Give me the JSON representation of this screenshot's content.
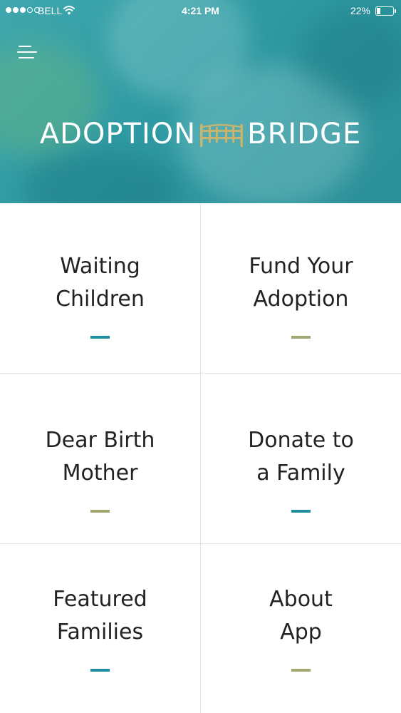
{
  "status_bar": {
    "carrier": "BELL",
    "time": "4:21 PM",
    "battery_percent": "22%",
    "battery_level": 0.22,
    "signal_bars_filled": 3,
    "signal_bars_total": 5
  },
  "header": {
    "logo_left": "ADOPTION",
    "logo_right": "BRIDGE",
    "logo_icon": "bridge-icon",
    "menu_icon": "hamburger-menu-icon"
  },
  "colors": {
    "teal_accent": "#1f8ea3",
    "olive_accent": "#a3a872",
    "bridge_gold": "#c9b46e",
    "hero_teal": "#35a2a9"
  },
  "tiles": [
    {
      "label_line1": "Waiting",
      "label_line2": "Children",
      "accent": "teal"
    },
    {
      "label_line1": "Fund Your",
      "label_line2": "Adoption",
      "accent": "olive"
    },
    {
      "label_line1": "Dear Birth",
      "label_line2": "Mother",
      "accent": "olive"
    },
    {
      "label_line1": "Donate to",
      "label_line2": "a Family",
      "accent": "teal"
    },
    {
      "label_line1": "Featured",
      "label_line2": "Families",
      "accent": "teal"
    },
    {
      "label_line1": "About",
      "label_line2": "App",
      "accent": "olive"
    }
  ]
}
